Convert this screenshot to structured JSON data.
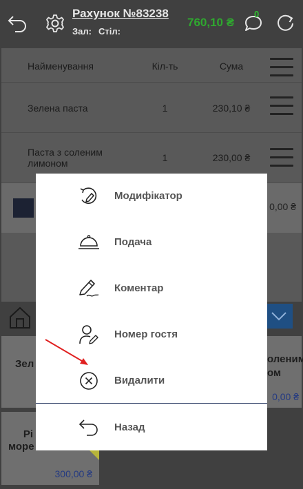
{
  "header": {
    "back_icon": "undo-arrow-icon",
    "settings_icon": "gear-icon",
    "title": "Рахунок №83238",
    "hall_label": "Зал:",
    "table_label": "Стіл:",
    "total": "760,10 ₴",
    "chat_count": "0",
    "refresh_icon": "refresh-icon"
  },
  "table": {
    "columns": [
      "Найменування",
      "Кіл-ть",
      "Сума"
    ],
    "rows": [
      {
        "name": "Зелена паста",
        "qty": "1",
        "sum": "230,10 ₴"
      },
      {
        "name": "Паста з соленим лимоном",
        "qty": "1",
        "sum": "230,00 ₴"
      }
    ],
    "partial_sum": "0,00 ₴"
  },
  "tiles": {
    "left_top": "Зел",
    "right_top": "оленим\nом",
    "right_top_price": "0,00 ₴",
    "left_bottom": "Рі\nморе",
    "left_bottom_price": "300,00 ₴"
  },
  "menu": {
    "items": [
      {
        "label": "Модифікатор",
        "icon": "modifier-icon"
      },
      {
        "label": "Подача",
        "icon": "serving-cloche-icon"
      },
      {
        "label": "Коментар",
        "icon": "pencil-icon"
      },
      {
        "label": "Номер гостя",
        "icon": "guest-icon"
      },
      {
        "label": "Видалити",
        "icon": "close-circle-icon"
      }
    ],
    "back_label": "Назад",
    "back_icon": "undo-arrow-icon"
  },
  "colors": {
    "accent_green": "#2fa82f",
    "price_blue": "#243a82",
    "annotation_red": "#e02020"
  }
}
